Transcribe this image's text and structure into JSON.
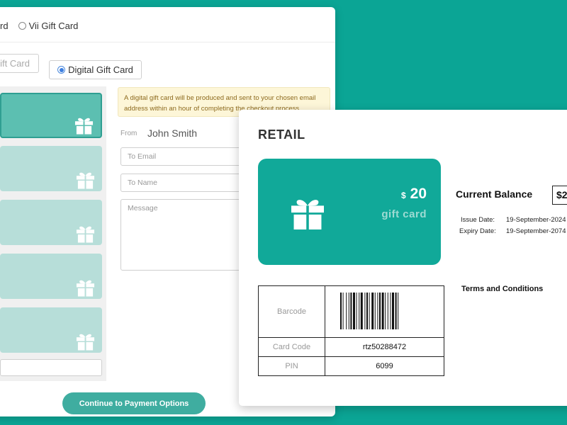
{
  "colors": {
    "background": "#0ba595",
    "card_teal": "#11a999",
    "tile_light": "#b7ded9",
    "tile_selected": "#5cbfb1",
    "button": "#3fada0",
    "note_bg": "#fdf6d8"
  },
  "purchase_form": {
    "card_type_options": [
      {
        "label": "rd",
        "selected": false
      },
      {
        "label": "Vii Gift Card",
        "selected": false
      }
    ],
    "format_buttons": [
      {
        "label": "ift Card",
        "selected": false
      },
      {
        "label": "Digital Gift Card",
        "selected": true
      }
    ],
    "card_tiles": [
      {
        "icon": "gift-icon",
        "selected": true
      },
      {
        "icon": "gift-icon",
        "selected": false
      },
      {
        "icon": "gift-icon",
        "selected": false
      },
      {
        "icon": "gift-icon",
        "selected": false
      },
      {
        "icon": "gift-icon",
        "selected": false
      }
    ],
    "notice": "A digital gift card will be produced and sent to your chosen email address within an hour of completing the checkout process.",
    "from_label": "From",
    "from_value": "John Smith",
    "to_email_placeholder": "To Email",
    "to_name_placeholder": "To Name",
    "message_placeholder": "Message",
    "continue_label": "Continue to Payment Options"
  },
  "gift_card": {
    "brand": "RETAIL",
    "currency": "$",
    "amount": "20",
    "card_label": "gift card",
    "balance_label": "Current Balance",
    "balance_value": "$2",
    "issue_label": "Issue Date:",
    "issue_value": "19-September-2024",
    "expiry_label": "Expiry Date:",
    "expiry_value": "19-September-2074",
    "terms_label": "Terms and Conditions",
    "barcode_label": "Barcode",
    "card_code_label": "Card Code",
    "card_code_value": "rtz50288472",
    "pin_label": "PIN",
    "pin_value": "6099"
  }
}
